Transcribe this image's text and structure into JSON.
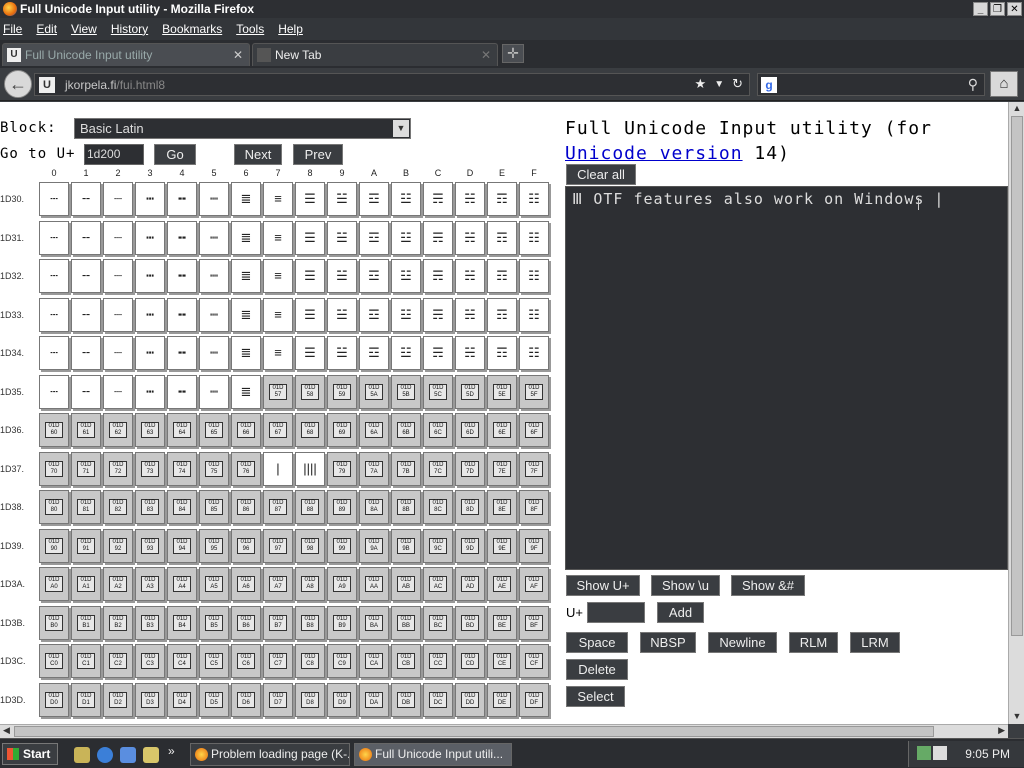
{
  "window": {
    "title": "Full Unicode Input utility - Mozilla Firefox",
    "controls": [
      "_",
      "❐",
      "✕"
    ]
  },
  "menu": [
    "File",
    "Edit",
    "View",
    "History",
    "Bookmarks",
    "Tools",
    "Help"
  ],
  "tabs": [
    {
      "label": "Full Unicode Input utility",
      "close": "✕"
    },
    {
      "label": "New Tab",
      "close": "✕"
    }
  ],
  "newtab": "✛",
  "nav": {
    "back": "←",
    "url_host": "jkorpela.fi",
    "url_path": "/fui.html8",
    "home": "⌂",
    "star": "★",
    "drop": "▼",
    "reload": "↻",
    "search_icon": "⚲"
  },
  "page": {
    "block_label": "Block:",
    "block_value": "Basic Latin",
    "goto_label": "Go to U+",
    "goto_value": "1d200",
    "go": "Go",
    "next": "Next",
    "prev": "Prev",
    "title_line1": "Full Unicode Input utility (for",
    "title_link": "Unicode version",
    "title_line2_rest": " 14)",
    "clear_all": "Clear all",
    "text_content": "Ⅲ OTF features also work on Windows |",
    "show_uplus": "Show U+",
    "show_u": "Show \\u",
    "show_amp": "Show &#",
    "uplus_label": "U+",
    "add": "Add",
    "space": "Space",
    "nbsp": "NBSP",
    "newline": "Newline",
    "rlm": "RLM",
    "lrm": "LRM",
    "delete": "Delete",
    "select": "Select"
  },
  "grid": {
    "columns": [
      "0",
      "1",
      "2",
      "3",
      "4",
      "5",
      "6",
      "7",
      "8",
      "9",
      "A",
      "B",
      "C",
      "D",
      "E",
      "F"
    ],
    "rows": [
      "1D30.",
      "1D31.",
      "1D32.",
      "1D33.",
      "1D34.",
      "1D35.",
      "1D36.",
      "1D37.",
      "1D38.",
      "1D39.",
      "1D3A.",
      "1D3B.",
      "1D3C.",
      "1D3D."
    ]
  },
  "taskbar": {
    "start": "Start",
    "tasks": [
      "Problem loading page (K-...",
      "Full Unicode Input utili..."
    ],
    "more": "»",
    "clock": "9:05 PM"
  }
}
